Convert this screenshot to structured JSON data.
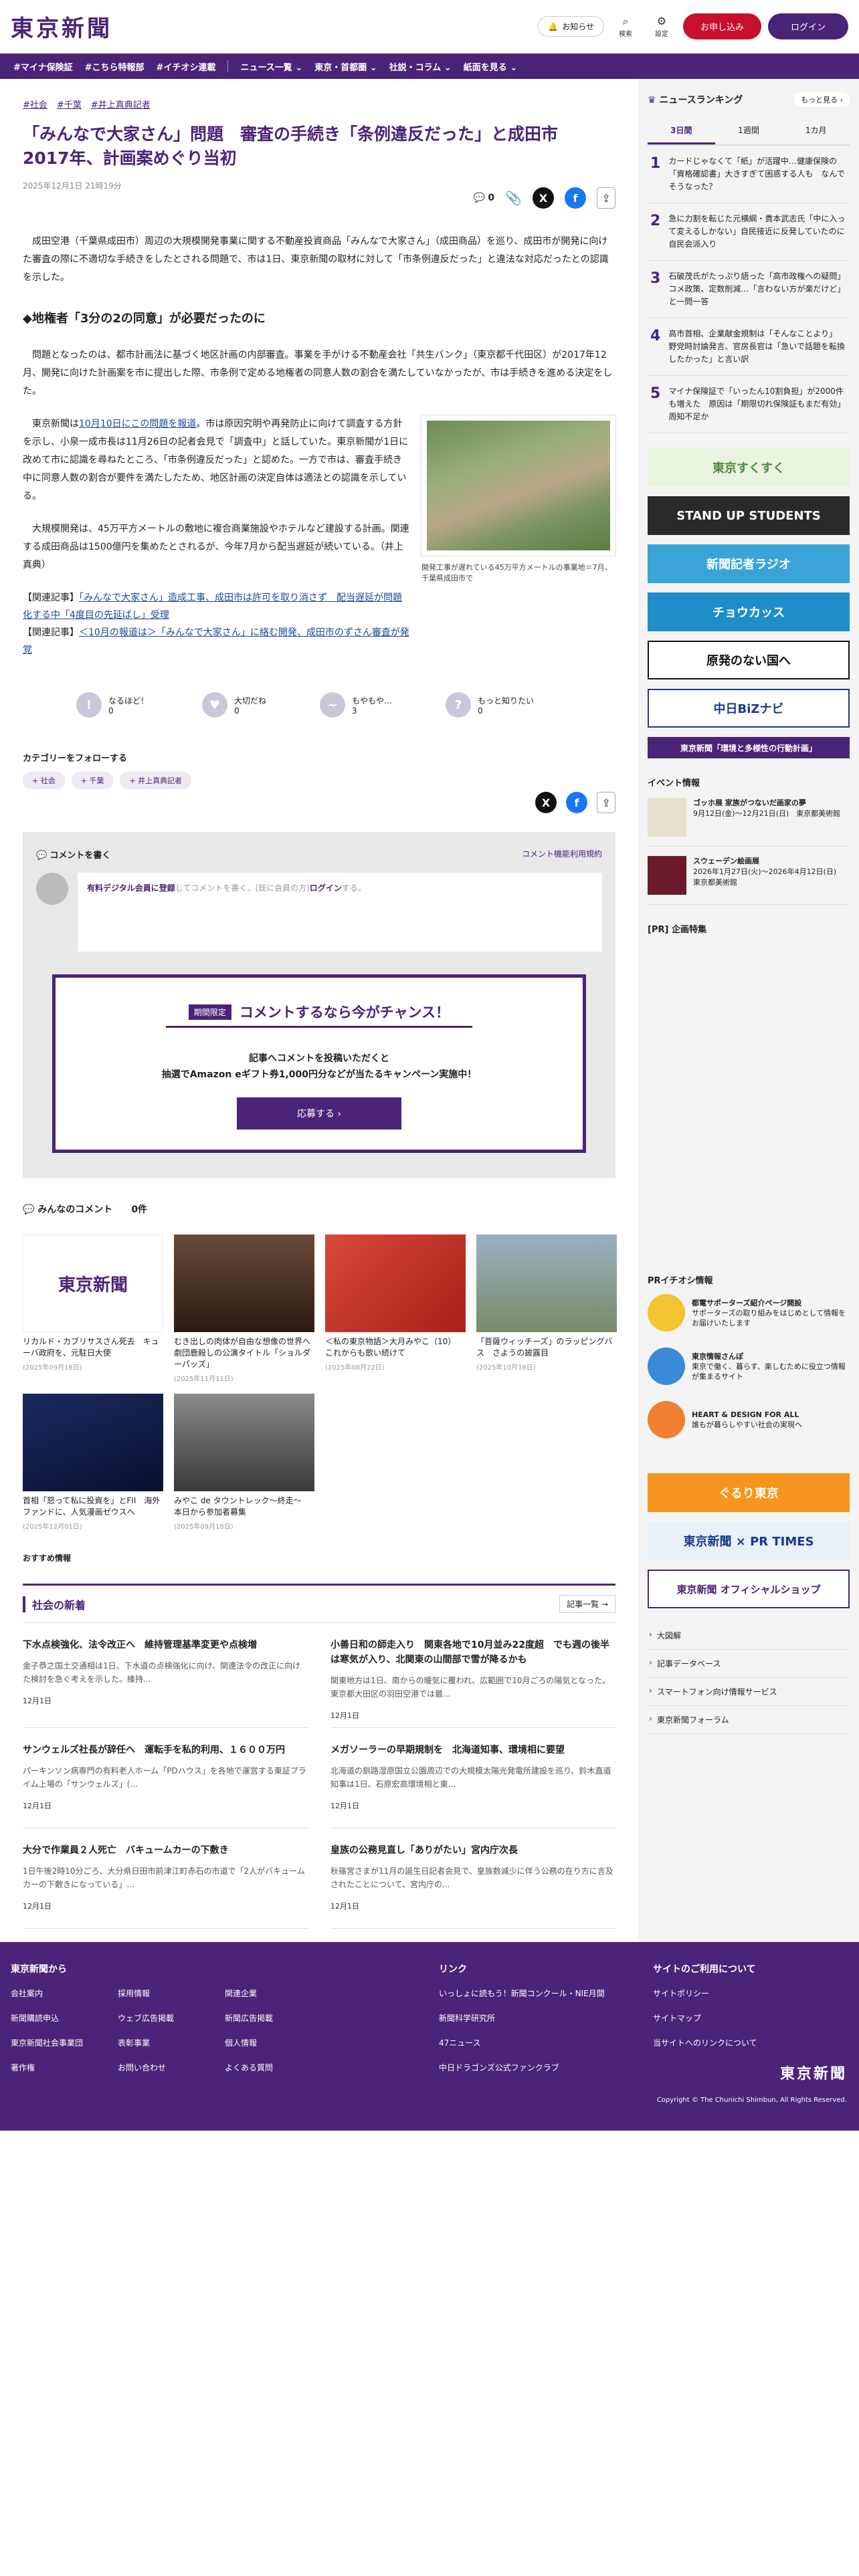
{
  "header": {
    "logo": "東京新聞",
    "notice": "お知らせ",
    "search": "検索",
    "settings": "設定",
    "subscribe": "お申し込み",
    "login": "ログイン"
  },
  "nav": [
    "#マイナ保険証",
    "#こちら特報部",
    "#イチオシ連載",
    "ニュース一覧 ⌄",
    "東京・首都圏 ⌄",
    "社説・コラム ⌄",
    "紙面を見る ⌄"
  ],
  "article": {
    "tags": [
      "#社会",
      "#千葉",
      "#井上真典記者"
    ],
    "title": "「みんなで大家さん」問題　審査の手続き「条例違反だった」と成田市　2017年、計画案めぐり当初",
    "date": "2025年12月1日 21時19分",
    "comment_count": "0",
    "p1": "成田空港（千葉県成田市）周辺の大規模開発事業に関する不動産投資商品「みんなで大家さん」（成田商品）を巡り、成田市が開発に向けた審査の際に不適切な手続きをしたとされる問題で、市は1日、東京新聞の取材に対して「市条例違反だった」と違法な対応だったとの認識を示した。",
    "h2": "◆地権者「3分の2の同意」が必要だったのに",
    "p2": "問題となったのは、都市計画法に基づく地区計画の内部審査。事業を手がける不動産会社「共生バンク」（東京都千代田区）が2017年12月、開発に向けた計画案を市に提出した際、市条例で定める地権者の同意人数の割合を満たしていなかったが、市は手続きを進める決定をした。",
    "p3a": "東京新聞は",
    "p3link": "10月10日にこの問題を報道",
    "p3b": "。市は原因究明や再発防止に向けて調査する方針を示し、小泉一成市長は11月26日の記者会見で「調査中」と話していた。東京新聞が1日に改めて市に認識を尋ねたところ、「市条例違反だった」と認めた。一方で市は、審査手続き中に同意人数の割合が要件を満たしたため、地区計画の決定自体は適法との認識を示している。",
    "p4": "大規模開発は、45万平方メートルの敷地に複合商業施設やホテルなど建設する計画。関連する成田商品は1500億円を集めたとされるが、今年7月から配当遅延が続いている。（井上真典）",
    "figure_caption": "開発工事が遅れている45万平方メートルの事業地＝7月、千葉県成田市で",
    "related1_label": "【関連記事】",
    "related1": "「みんなで大家さん」造成工事、成田市は許可を取り消さず　配当遅延が問題化する中「4度目の先延ばし」受理",
    "related2_label": "【関連記事】",
    "related2": "＜10月の報道は＞「みんなで大家さん」に絡む開発、成田市のずさん審査が発覚"
  },
  "reactions": [
    {
      "icon": "!",
      "label": "なるほど！",
      "count": "0"
    },
    {
      "icon": "♥",
      "label": "大切だね",
      "count": "0"
    },
    {
      "icon": "~",
      "label": "もやもや…",
      "count": "3"
    },
    {
      "icon": "?",
      "label": "もっと知りたい",
      "count": "0"
    }
  ],
  "follow": {
    "label": "カテゴリーをフォローする",
    "chips": [
      "+ 社会",
      "+ 千葉",
      "+ 井上真典記者"
    ]
  },
  "comments": {
    "write": "コメントを書く",
    "rules": "コメント機能利用規約",
    "member": "有料デジタル会員に登録",
    "placeholder_mid": "してコメントを書く。(既に会員の方)",
    "login": "ログイン",
    "placeholder_end": "する。",
    "promo_tag": "期間限定",
    "promo_title": "コメントするなら今がチャンス！",
    "promo_l1": "記事へコメントを投稿いただくと",
    "promo_l2": "抽選でAmazon eギフト券1,000円分などが当たるキャンペーン実施中！",
    "promo_btn": "応募する ›",
    "all": "みんなのコメント",
    "all_count": "0件"
  },
  "cards": [
    {
      "title": "リカルド・カブリサスさん死去　キューバ政府を、元駐日大使",
      "date": "(2025年09月18日)",
      "color": "#ffffff"
    },
    {
      "title": "むき出しの肉体が自由な想像の世界へ　劇団鹿殺しの公演タイトル「ショルダーパッズ」",
      "date": "(2025年11月11日)",
      "color": "#3a2a22"
    },
    {
      "title": "＜私の東京物語＞大月みやこ（10）　これからも歌い続けて",
      "date": "(2025年08月22日)",
      "color": "#c8302a"
    },
    {
      "title": "「菩薩ウィッチーズ」のラッピングバス　さようの披露目",
      "date": "(2025年10月18日)",
      "color": "#8a9a7a"
    },
    {
      "title": "首相「怒って私に投資を」とFII　海外ファンドに、人気漫画ゼウスへ",
      "date": "(2025年12月01日)",
      "color": "#101840"
    },
    {
      "title": "みやこ de タウントレック〜終走〜　本日から参加者募集",
      "date": "(2025年09月18日)",
      "color": "#555555"
    }
  ],
  "osusume": "おすすめ情報",
  "social_news": {
    "title": "社会の新着",
    "more": "記事一覧 →",
    "items": [
      {
        "title": "下水点検強化、法令改正へ　維持管理基準変更や点検増",
        "body": "金子恭之国土交通相は1日、下水道の点検強化に向け、関連法令の改正に向けた検討を急ぐ考えを示した。維持...",
        "date": "12月1日"
      },
      {
        "title": "小善日和の師走入り　関東各地で10月並み22度超　でも週の後半は寒気が入り、北関東の山間部で雪が降るかも",
        "body": "関東地方は1日、南からの暖気に覆われ、広範囲で10月ごろの陽気となった。東京都大田区の羽田空港では最...",
        "date": "12月1日"
      },
      {
        "title": "サンウェルズ社長が辞任へ　運転手を私的利用、１６００万円",
        "body": "パーキンソン病専門の有料老人ホーム「PDハウス」を各地で運営する東証プライム上場の「サンウェルズ」(...",
        "date": "12月1日"
      },
      {
        "title": "メガソーラーの早期規制を　北海道知事、環境相に要望",
        "body": "北海道の釧路湿原国立公園周辺での大規模太陽光発電所建設を巡り、鈴木直道知事は1日、石原宏高環境相と東...",
        "date": "12月1日"
      },
      {
        "title": "大分で作業員２人死亡　バキュームカーの下敷き",
        "body": "1日午後2時10分ごろ、大分県日田市前津江町赤石の市道で「2人がバキュームカーの下敷きになっている」...",
        "date": "12月1日"
      },
      {
        "title": "皇族の公務見直し「ありがたい」宮内庁次長",
        "body": "秋篠宮さまが11月の誕生日記者会見で、皇族数減少に伴う公務の在り方に言及されたことについて、宮内庁の...",
        "date": "12月1日"
      }
    ]
  },
  "ranking": {
    "title": "ニュースランキング",
    "more": "もっと見る ›",
    "tabs": [
      "3日間",
      "1週間",
      "1カ月"
    ],
    "items": [
      {
        "n": "1",
        "t": "カードじゃなくて「紙」が活躍中…健康保険の「資格確認書」大きすぎて困惑する人も　なんでそうなった？"
      },
      {
        "n": "2",
        "t": "急に力割を転じた元横綱・貴本武志氏「中に入って変えるしかない」自民接近に反発していたのに自民会派入り"
      },
      {
        "n": "3",
        "t": "石破茂氏がたっぷり語った「高市政権への疑問」コメ政策、定数削減…「言わない方が楽だけど」と一問一答"
      },
      {
        "n": "4",
        "t": "高市首相、企業献金規制は「そんなことより」　野党時討論発言、官房長官は「急いで話題を転換したかった」と言い訳"
      },
      {
        "n": "5",
        "t": "マイナ保険証で「いったん10割負担」が2000件も増えた　原因は「期限切れ保険証もまだ有効」周知不足か"
      }
    ]
  },
  "banners": [
    {
      "text": "東京すくすく",
      "bg": "#e8f3e0",
      "fg": "#4b8a3a"
    },
    {
      "text": "STAND UP STUDENTS",
      "bg": "#2a2a2a",
      "fg": "#ffffff"
    },
    {
      "text": "新聞記者ラジオ",
      "bg": "#3aa4d8",
      "fg": "#ffffff"
    },
    {
      "text": "チョウカッス",
      "bg": "#1e8ec8",
      "fg": "#ffffff"
    },
    {
      "text": "原発のない国へ",
      "bg": "#ffffff",
      "fg": "#111111"
    },
    {
      "text": "中日BiZナビ",
      "bg": "#ffffff",
      "fg": "#1a3a8a"
    },
    {
      "text": "東京新聞「環境と多様性の行動計画」",
      "bg": "#4b2378",
      "fg": "#ffffff"
    }
  ],
  "events": {
    "title": "イベント情報",
    "items": [
      {
        "t": "ゴッホ展 家族がつないだ画家の夢",
        "d": "9月12日(金)〜12月21日(日)　東京都美術館",
        "color": "#e8e0d0"
      },
      {
        "t": "スウェーデン絵画展",
        "d": "2026年1月27日(火)〜2026年4月12日(日)　東京都美術館",
        "color": "#6a1a2a"
      }
    ]
  },
  "pr_title": "[PR] 企画特集",
  "pr_ichioshi": {
    "title": "PRイチオシ情報",
    "items": [
      {
        "t": "都電サポーターズ紹介ページ開設",
        "d": "サポーターズの取り組みをはじめとして情報をお届けいたします",
        "color": "#f4c430"
      },
      {
        "t": "東京情報さんぽ",
        "d": "東京で働く、暮らす、楽しむために役立つ情報が集まるサイト",
        "color": "#3a8ad8"
      },
      {
        "t": "HEART & DESIGN FOR ALL",
        "d": "誰もが暮らしやすい社会の実現へ",
        "color": "#f08030"
      }
    ]
  },
  "side_banners2": [
    {
      "text": "ぐるり東京",
      "bg": "#f7941d",
      "fg": "#ffffff"
    },
    {
      "text": "東京新聞 × PR TIMES",
      "bg": "#e8f0f8",
      "fg": "#1a3a8a"
    },
    {
      "text": "東京新聞 オフィシャルショップ",
      "bg": "#ffffff",
      "fg": "#4b2378"
    }
  ],
  "side_links": [
    "大図解",
    "記事データベース",
    "スマートフォン向け情報サービス",
    "東京新聞フォーラム"
  ],
  "footer": {
    "col1_title": "東京新聞から",
    "col1": [
      "会社案内",
      "採用情報",
      "関連企業",
      "新聞購読申込",
      "ウェブ広告掲載",
      "新聞広告掲載",
      "東京新聞社会事業団",
      "表彰事業",
      "個人情報",
      "著作権",
      "お問い合わせ",
      "よくある質問"
    ],
    "col2_title": "リンク",
    "col2": [
      "いっしょに読もう！新聞コンクール・NIE月間",
      "新聞科学研究所",
      "47ニュース",
      "中日ドラゴンズ公式ファンクラブ"
    ],
    "col3_title": "サイトのご利用について",
    "col3": [
      "サイトポリシー",
      "サイトマップ",
      "当サイトへのリンクについて"
    ],
    "logo": "東京新聞",
    "copyright": "Copyright © The Chunichi Shimbun, All Rights Reserved."
  }
}
